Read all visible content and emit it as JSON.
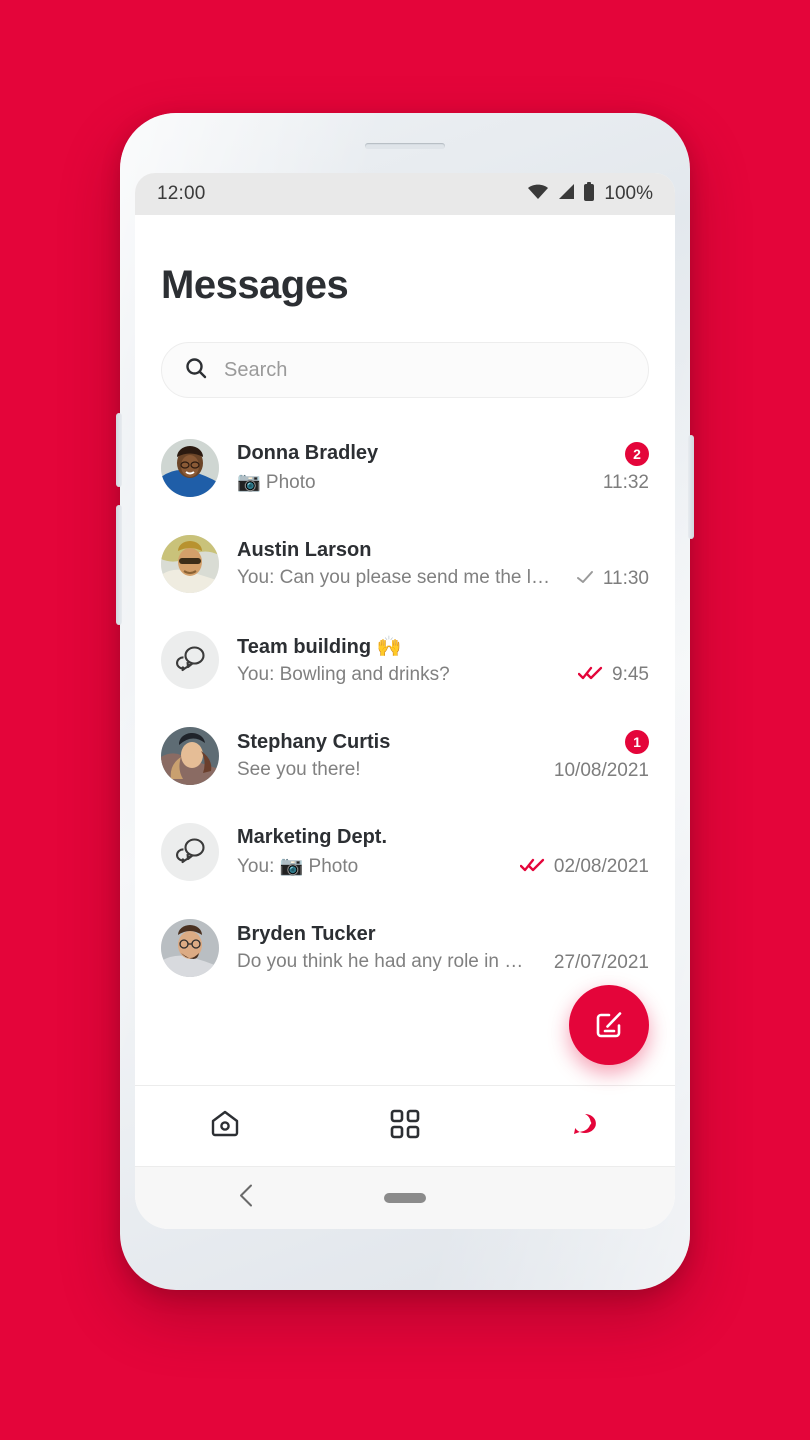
{
  "background_color": "#e4053a",
  "accent_color": "#e4053a",
  "statusbar": {
    "time": "12:00",
    "battery": "100%",
    "icons": [
      "wifi-icon",
      "cellular-signal-icon",
      "battery-icon"
    ]
  },
  "header": {
    "title": "Messages"
  },
  "search": {
    "placeholder": "Search",
    "value": "",
    "icon": "search-icon"
  },
  "conversations": [
    {
      "name": "Donna Bradley",
      "preview": "📷 Photo",
      "timestamp": "11:32",
      "unread": "2",
      "receipt": "none",
      "avatar": "photo-woman-glasses"
    },
    {
      "name": "Austin Larson",
      "preview": "You: Can you please send me the lat…",
      "timestamp": "11:30",
      "unread": "",
      "receipt": "single-check",
      "avatar": "photo-man-sunglasses"
    },
    {
      "name": "Team building 🙌",
      "preview": "You: Bowling and drinks?",
      "timestamp": "9:45",
      "unread": "",
      "receipt": "double-check",
      "avatar": "group-chat-icon"
    },
    {
      "name": "Stephany Curtis",
      "preview": "See you there!",
      "timestamp": "10/08/2021",
      "unread": "1",
      "receipt": "none",
      "avatar": "photo-woman-hat"
    },
    {
      "name": "Marketing Dept.",
      "preview": "You: 📷 Photo",
      "timestamp": "02/08/2021",
      "unread": "",
      "receipt": "double-check",
      "avatar": "group-chat-icon"
    },
    {
      "name": "Bryden Tucker",
      "preview": "Do you think he had any role in m…",
      "timestamp": "27/07/2021",
      "unread": "",
      "receipt": "none",
      "avatar": "photo-man-beard"
    }
  ],
  "fab": {
    "label": "",
    "icon": "compose-icon"
  },
  "bottom_nav": [
    {
      "icon": "home-icon",
      "active": false
    },
    {
      "icon": "grid-apps-icon",
      "active": false
    },
    {
      "icon": "chat-bubble-icon",
      "active": true
    }
  ],
  "android_nav": {
    "back_icon": "back-chevron-icon",
    "home_pill": "home-indicator"
  }
}
